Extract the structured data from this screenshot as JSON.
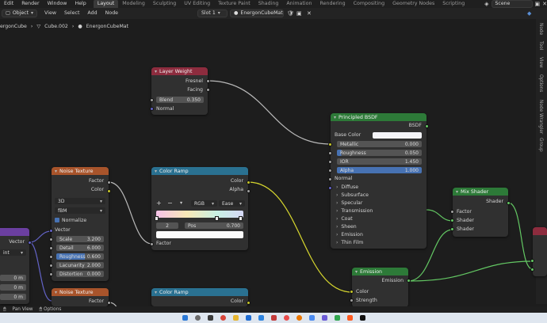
{
  "topbar": {
    "menus": [
      "Edit",
      "Render",
      "Window",
      "Help"
    ],
    "workspace_tabs": [
      "Layout",
      "Modeling",
      "Sculpting",
      "UV Editing",
      "Texture Paint",
      "Shading",
      "Animation",
      "Rendering",
      "Compositing",
      "Geometry Nodes",
      "Scripting"
    ],
    "active_tab": "Layout",
    "scene_label": "Scene"
  },
  "header": {
    "mode": "Object",
    "menus": [
      "View",
      "Select",
      "Add",
      "Node"
    ],
    "slot": "Slot 1",
    "material": "EnergonCubeMat"
  },
  "breadcrumbs": [
    "ergonCube",
    "Cube.002",
    "EnergonCubeMat"
  ],
  "sidebar_tabs": [
    "Node",
    "Tool",
    "View",
    "Options",
    "Node Wrangler",
    "Group"
  ],
  "status": {
    "pan_view": "Pan View",
    "options": "Options"
  },
  "nodes": {
    "layer_weight": {
      "title": "Layer Weight",
      "out_fresnel": "Fresnel",
      "out_facing": "Facing",
      "blend_label": "Blend",
      "blend_value": "0.350",
      "in_normal": "Normal"
    },
    "principled": {
      "title": "Principled BSDF",
      "out_bsdf": "BSDF",
      "base_color": "Base Color",
      "metallic_label": "Metallic",
      "metallic_value": "0.000",
      "roughness_label": "Roughness",
      "roughness_value": "0.050",
      "ior_label": "IOR",
      "ior_value": "1.450",
      "alpha_label": "Alpha",
      "alpha_value": "1.000",
      "normal": "Normal",
      "panels": [
        "Diffuse",
        "Subsurface",
        "Specular",
        "Transmission",
        "Coat",
        "Sheen",
        "Emission",
        "Thin Film"
      ]
    },
    "noise": {
      "title": "Noise Texture",
      "out_factor": "Factor",
      "out_color": "Color",
      "dim": "3D",
      "type": "fBM",
      "normalize": "Normalize",
      "in_vector": "Vector",
      "scale_label": "Scale",
      "scale_value": "3.200",
      "detail_label": "Detail",
      "detail_value": "6.000",
      "roughness_label": "Roughness",
      "roughness_value": "0.600",
      "lacunarity_label": "Lacunarity",
      "lacunarity_value": "2.000",
      "distortion_label": "Distortion",
      "distortion_value": "0.000"
    },
    "color_ramp": {
      "title": "Color Ramp",
      "out_color": "Color",
      "out_alpha": "Alpha",
      "add": "+",
      "remove": "−",
      "mode": "RGB",
      "interp": "Ease",
      "index": "2",
      "pos_label": "Pos",
      "pos_value": "0.700",
      "in_factor": "Factor"
    },
    "mix_shader": {
      "title": "Mix Shader",
      "out_shader": "Shader",
      "in_factor": "Factor",
      "in_shader1": "Shader",
      "in_shader2": "Shader"
    },
    "emission": {
      "title": "Emission",
      "out_emission": "Emission",
      "in_color": "Color",
      "in_strength": "Strength"
    },
    "noise2": {
      "title": "Noise Texture",
      "out_factor": "Factor"
    },
    "color_ramp2": {
      "title": "Color Ramp",
      "out_color": "Color"
    },
    "left_partial": {
      "out_vector": "Vector",
      "dropdown": "int",
      "values": [
        "0 m",
        "0 m",
        "0 m"
      ]
    }
  },
  "colors": {
    "socket_float": "#a1a1a1",
    "socket_color": "#c7c729",
    "socket_shader": "#63c763",
    "socket_vector": "#6363c7",
    "header_converter": "#2a7191",
    "header_input": "#8d2c3e",
    "header_texture": "#a8542b",
    "header_shader": "#2d7a38",
    "accent_field": "#4772b3"
  }
}
